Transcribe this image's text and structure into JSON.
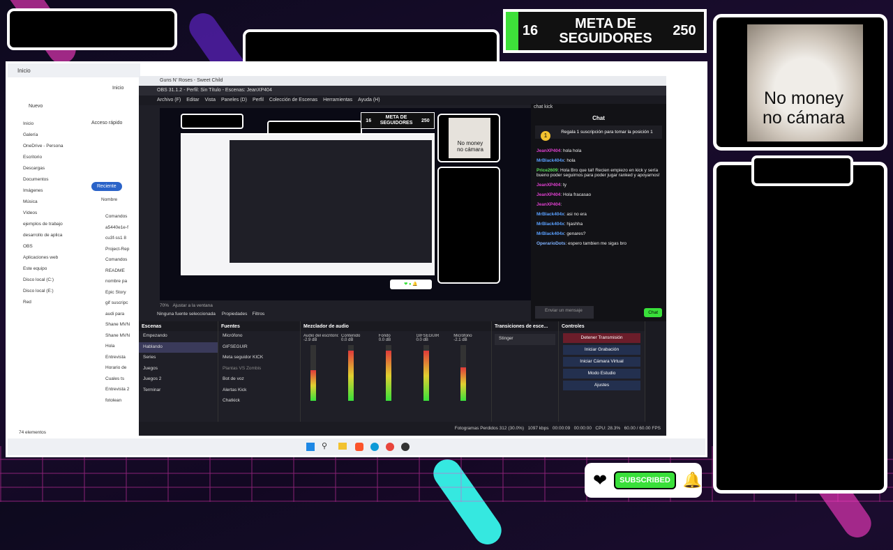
{
  "overlay": {
    "goal": {
      "current": "16",
      "title_line1": "META DE",
      "title_line2": "SEGUIDORES",
      "max": "250",
      "fill_fraction": 0.064
    },
    "cam_caption_line1": "No money",
    "cam_caption_line2": "no cámara",
    "subscribe_label": "SUBSCRIBED"
  },
  "explorer": {
    "tab": "Inicio",
    "toolbar_new": "Nuevo",
    "address": "Inicio",
    "quick_access": "Acceso rápido",
    "recent": "Reciente",
    "column_name": "Nombre",
    "sidebar": [
      "Inicio",
      "Galería",
      "OneDrive - Persona",
      "Escritorio",
      "Descargas",
      "Documentos",
      "Imágenes",
      "Música",
      "Vídeos",
      "ejemplos de trabajo",
      "desarrollo de aplica",
      "OBS",
      "Aplicaciones web",
      "Este equipo",
      "Disco local (C:)",
      "Disco local (E:)",
      "Red"
    ],
    "files": [
      "Comandos",
      "a5440e1e-f",
      "cu3f-ss1 8",
      "Project-Rep",
      "Comandos",
      "README",
      "nombre pa",
      "Epic Story",
      "gif suscripc",
      "audi para",
      "Shane MVN",
      "Shane MVN",
      "Hola",
      "Entrevista",
      "Horario de",
      "Cuales ts",
      "Entrevista 2",
      "fotolean"
    ],
    "items_count": "74 elementos"
  },
  "obs": {
    "browser_tab": "Guns N' Roses - Sweet Child",
    "title": "OBS 31.1.2 - Perfil: Sin Título - Escenas: JeanXP404",
    "menu": [
      "Archivo (F)",
      "Editar",
      "Vista",
      "Paneles (D)",
      "Perfil",
      "Colección de Escenas",
      "Herramientas",
      "Ayuda (H)"
    ],
    "zoom": "70%",
    "fit": "Ajustar a la ventana",
    "no_source": "Ninguna fuente seleccionada",
    "properties": "Propiedades",
    "filters": "Filtros",
    "docks": {
      "scenes_title": "Escenas",
      "scenes": [
        "Empezando",
        "Hablando",
        "Series",
        "Juegos",
        "Juegos 2",
        "Terminar"
      ],
      "sources_title": "Fuentes",
      "sources": [
        "Micrófono",
        "GIFSEGUIR",
        "Meta seguidor KICK",
        "Plantas VS Zombis",
        "Bot de voz",
        "Alertas Kick",
        "Chatkick"
      ],
      "mixer_title": "Mezclador de audio",
      "mixer": [
        {
          "name": "Audio del escritorio",
          "db": "-2.9 dB",
          "level": 0.55
        },
        {
          "name": "Contenido",
          "db": "0.0 dB",
          "level": 0.9
        },
        {
          "name": "Fondo",
          "db": "0.0 dB",
          "level": 0.9
        },
        {
          "name": "GIFSEGUIR",
          "db": "0.0 dB",
          "level": 0.9
        },
        {
          "name": "Micrófono",
          "db": "-2.1 dB",
          "level": 0.6
        }
      ],
      "transitions_title": "Transiciones de esce...",
      "transition": "Stinger",
      "controls_title": "Controles",
      "controls": [
        "Detener Transmisión",
        "Iniciar Grabación",
        "Iniciar Cámara Virtual",
        "Modo Estudio",
        "Ajustes"
      ]
    },
    "status": {
      "frames": "Fotogramas Perdidos 312 (30.0%)",
      "kbps": "1097 kbps",
      "stream_time": "00:00:09",
      "rec_time": "00:00:00",
      "cpu": "CPU: 28.3%",
      "fps": "60.00 / 60.00 FPS"
    },
    "chat": {
      "dock_title": "chat kick",
      "title": "Chat",
      "gift": "Regala 1 suscripción para tomar la posición 1",
      "messages": [
        {
          "user": "JeanXP404",
          "text": ": hola hola",
          "kind": "p"
        },
        {
          "user": "MrBlack404x",
          "text": ": hola",
          "kind": "b"
        },
        {
          "user": "Price2609",
          "text": ": Hola Bro que tal! Recien empiezo en kick y sería bueno poder seguirnos para poder jugar ranked y apoyarnos!",
          "kind": "g"
        },
        {
          "user": "JeanXP404",
          "text": ": ty",
          "kind": "p"
        },
        {
          "user": "JeanXP404",
          "text": ": Hola fracasao",
          "kind": "p"
        },
        {
          "user": "JeanXP404",
          "text": ":",
          "kind": "p"
        },
        {
          "user": "MrBlack404x",
          "text": ": asi no era",
          "kind": "b"
        },
        {
          "user": "MrBlack404x",
          "text": ": hjashha",
          "kind": "b"
        },
        {
          "user": "MrBlack404x",
          "text": ": genares?",
          "kind": "b"
        },
        {
          "user": "OperarioDots",
          "text": ": espero tambien me sigas bro",
          "kind": "o"
        }
      ],
      "input_placeholder": "Enviar un mensaje",
      "send": "Chat"
    }
  },
  "colors": {
    "accent_green": "#39e03a",
    "stop_red": "#6b1d2a",
    "control_blue": "#23304f",
    "neon_pink": "#ff3cc8",
    "neon_cyan": "#35e8e0"
  }
}
